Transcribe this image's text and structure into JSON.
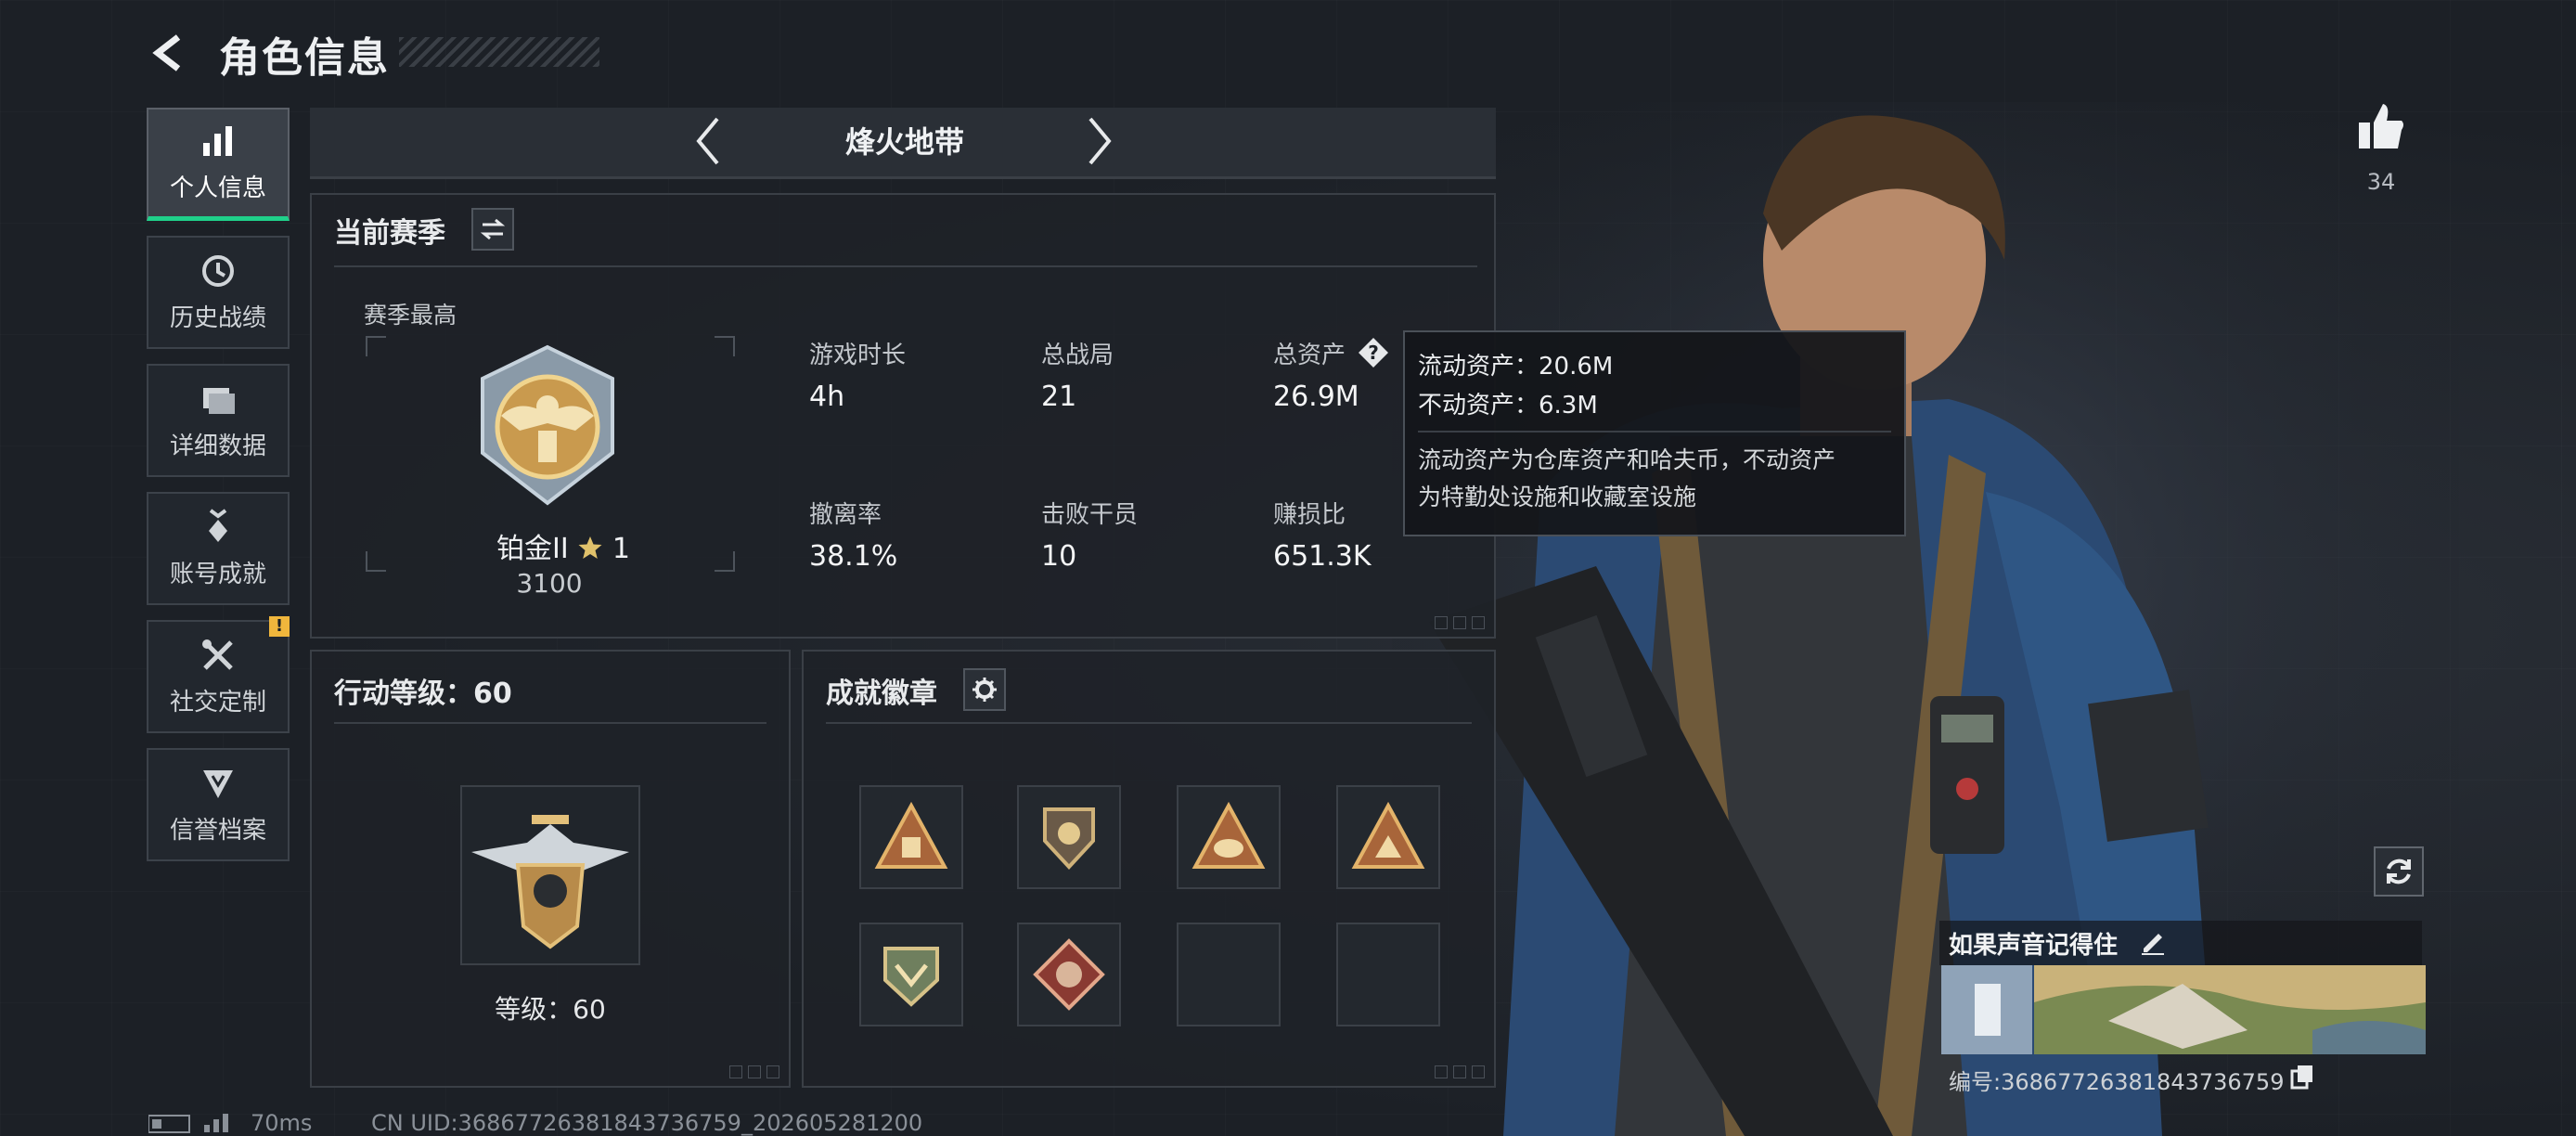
{
  "header": {
    "title": "角色信息"
  },
  "sidebar": {
    "items": [
      {
        "label": "个人信息",
        "icon": "bar-chart-icon",
        "active": true
      },
      {
        "label": "历史战绩",
        "icon": "clock-icon"
      },
      {
        "label": "详细数据",
        "icon": "folder-icon"
      },
      {
        "label": "账号成就",
        "icon": "medal-icon"
      },
      {
        "label": "社交定制",
        "icon": "tools-icon",
        "badge": "!"
      },
      {
        "label": "信誉档案",
        "icon": "shield-icon"
      }
    ]
  },
  "mode": {
    "label": "烽火地带"
  },
  "season": {
    "title": "当前赛季",
    "best_label": "赛季最高",
    "rank_name": "铂金II",
    "rank_stars": "1",
    "rank_points": "3100",
    "stats": [
      {
        "label": "游戏时长",
        "value": "4h"
      },
      {
        "label": "总战局",
        "value": "21"
      },
      {
        "label": "总资产",
        "value": "26.9M"
      },
      {
        "label": "撤离率",
        "value": "38.1%"
      },
      {
        "label": "击败干员",
        "value": "10"
      },
      {
        "label": "赚损比",
        "value": "651.3K"
      }
    ]
  },
  "tooltip": {
    "line1": "流动资产：20.6M",
    "line2": "不动资产：6.3M",
    "desc1": "流动资产为仓库资产和哈夫币，不动资产",
    "desc2": "为特勤处设施和收藏室设施"
  },
  "level": {
    "title": "行动等级：60",
    "label": "等级：60"
  },
  "badges": {
    "title": "成就徽章",
    "slots": 8,
    "filled": 6
  },
  "likes": {
    "count": "34"
  },
  "card": {
    "name": "如果声音记得住",
    "id": "编号:36867726381843736759"
  },
  "status": {
    "ping": "70ms",
    "uid": "CN UID:36867726381843736759_202605281200"
  },
  "colors": {
    "accent": "#1fd08a",
    "warning": "#f0b63c",
    "gold": "#d9b36a"
  }
}
